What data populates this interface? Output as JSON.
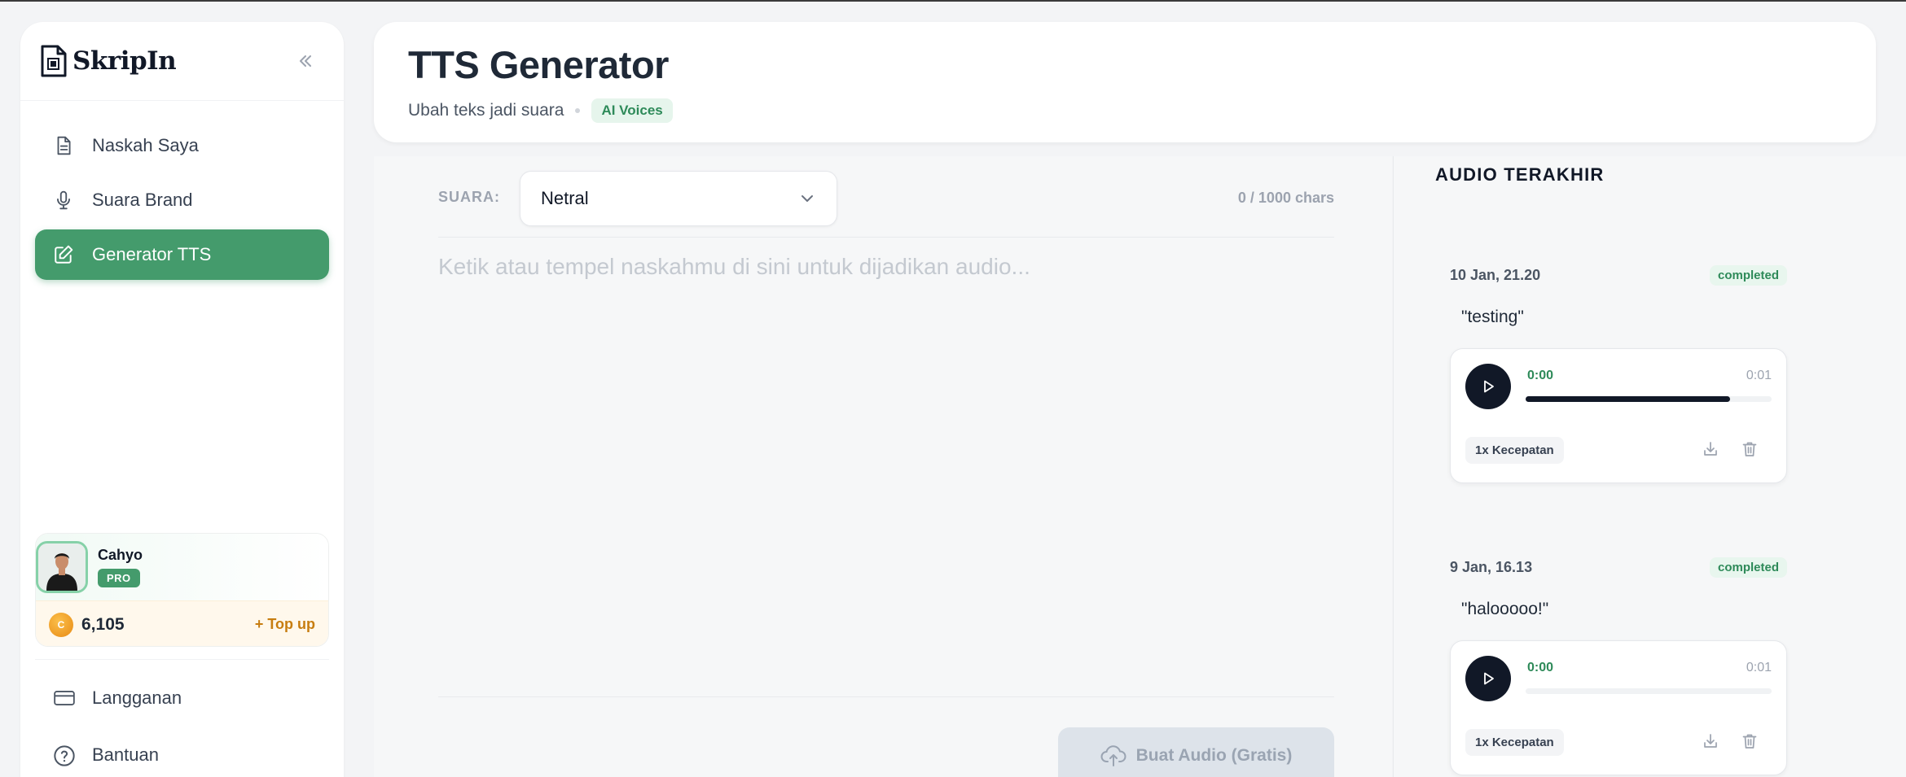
{
  "app": {
    "name": "SkripIn"
  },
  "sidebar": {
    "items": [
      {
        "label": "Naskah Saya",
        "icon": "document-icon",
        "active": false
      },
      {
        "label": "Suara Brand",
        "icon": "microphone-icon",
        "active": false
      },
      {
        "label": "Generator TTS",
        "icon": "edit-icon",
        "active": true
      }
    ],
    "bottom_items": [
      {
        "label": "Langganan",
        "icon": "credit-card-icon"
      },
      {
        "label": "Bantuan",
        "icon": "help-icon"
      }
    ]
  },
  "user": {
    "name": "Cahyo",
    "plan": "PRO",
    "credits": "6,105",
    "coin_symbol": "C",
    "topup_label": "+ Top up"
  },
  "header": {
    "title": "TTS Generator",
    "subtitle": "Ubah teks jadi suara",
    "badge": "AI Voices"
  },
  "editor": {
    "voice_label": "SUARA:",
    "voice_selected": "Netral",
    "char_count": "0 / 1000 chars",
    "placeholder": "Ketik atau tempel naskahmu di sini untuk dijadikan audio...",
    "button_label": "Buat Audio (Gratis)"
  },
  "recent": {
    "title": "AUDIO TERAKHIR",
    "items": [
      {
        "date": "10 Jan, 21.20",
        "status": "completed",
        "text": "\"testing\"",
        "current_time": "0:00",
        "total_time": "0:01",
        "progress": 0.83,
        "speed": "1x Kecepatan"
      },
      {
        "date": "9 Jan, 16.13",
        "status": "completed",
        "text": "\"halooooo!\"",
        "current_time": "0:00",
        "total_time": "0:01",
        "progress": 0,
        "speed": "1x Kecepatan"
      }
    ]
  },
  "colors": {
    "accent": "#449b6c",
    "dark": "#111827",
    "credit": "#c77d10"
  }
}
